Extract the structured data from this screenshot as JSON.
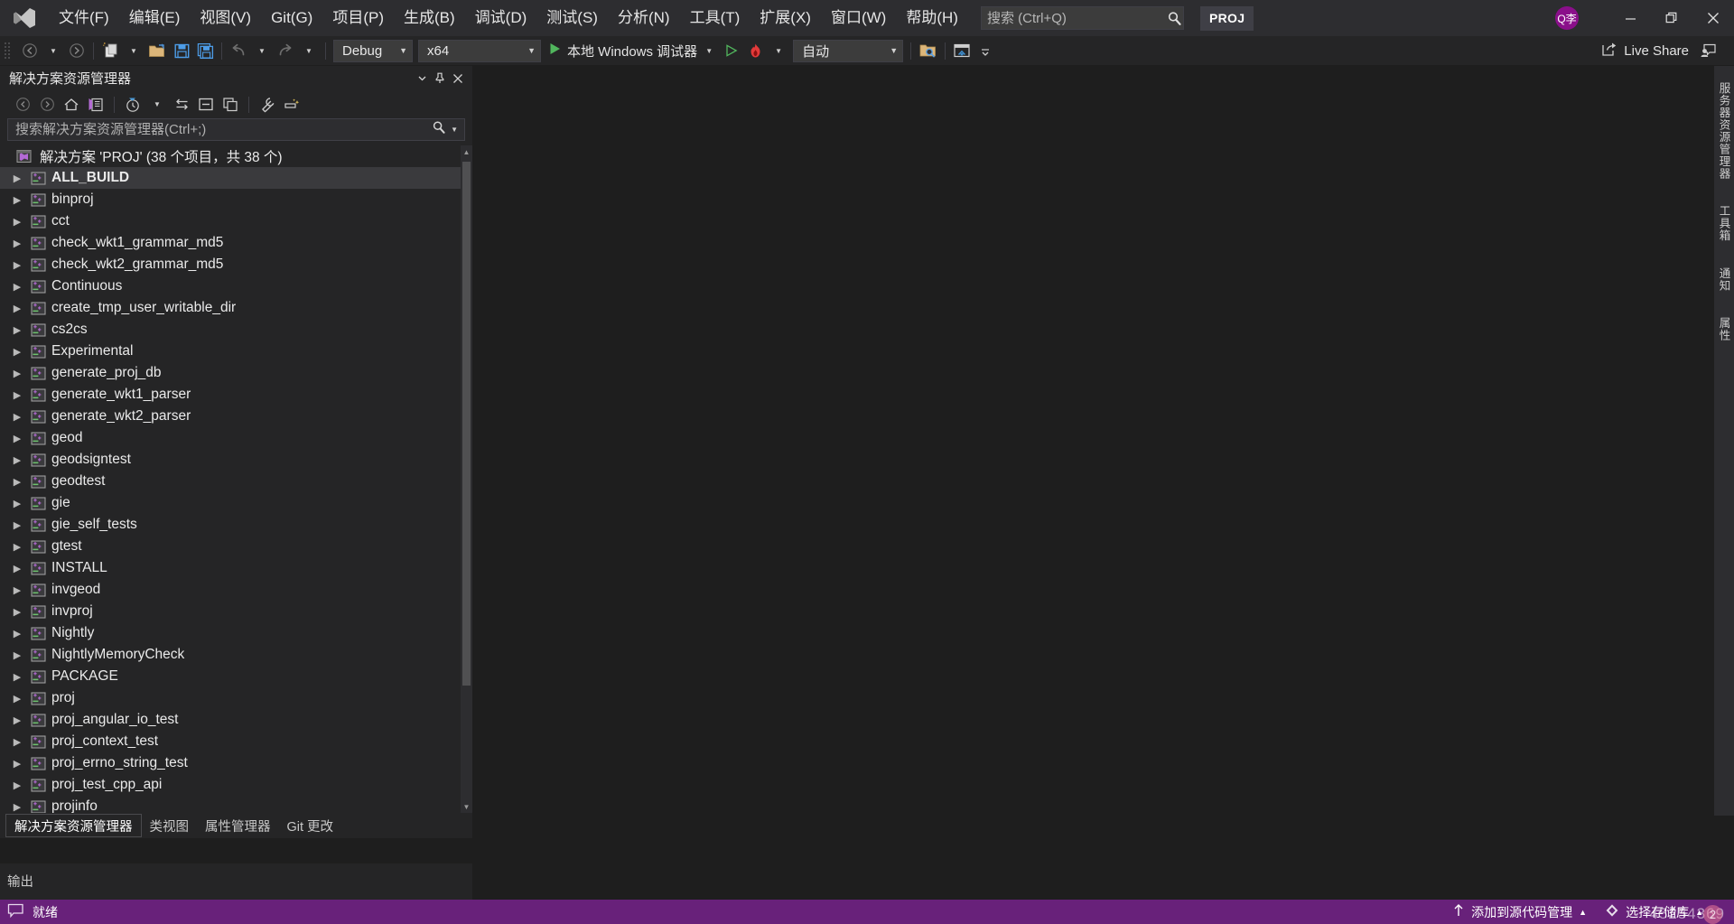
{
  "app": {
    "title_badge": "PROJ",
    "logo_icon": "visual-studio-logo-icon"
  },
  "menu": {
    "items": [
      {
        "label": "文件(F)",
        "name": "menu-file"
      },
      {
        "label": "编辑(E)",
        "name": "menu-edit"
      },
      {
        "label": "视图(V)",
        "name": "menu-view"
      },
      {
        "label": "Git(G)",
        "name": "menu-git"
      },
      {
        "label": "项目(P)",
        "name": "menu-project"
      },
      {
        "label": "生成(B)",
        "name": "menu-build"
      },
      {
        "label": "调试(D)",
        "name": "menu-debug"
      },
      {
        "label": "测试(S)",
        "name": "menu-test"
      },
      {
        "label": "分析(N)",
        "name": "menu-analyze"
      },
      {
        "label": "工具(T)",
        "name": "menu-tools"
      },
      {
        "label": "扩展(X)",
        "name": "menu-extensions"
      },
      {
        "label": "窗口(W)",
        "name": "menu-window"
      },
      {
        "label": "帮助(H)",
        "name": "menu-help"
      }
    ]
  },
  "search": {
    "placeholder": "搜索 (Ctrl+Q)",
    "value": "",
    "icon": "magnifier-icon"
  },
  "account": {
    "initials": "Q李",
    "color": "#8a0f8a"
  },
  "window_controls": {
    "minimize": "—",
    "restore": "restore-icon",
    "close": "✕"
  },
  "toolbar": {
    "back_icon": "arrow-back-icon",
    "forward_icon": "arrow-forward-icon",
    "new_item_icon": "new-project-icon",
    "open_icon": "open-folder-icon",
    "save_icon": "save-icon",
    "save_all_icon": "save-all-icon",
    "undo_icon": "undo-icon",
    "redo_icon": "redo-icon",
    "configuration": "Debug",
    "platform": "x64",
    "run_label": "本地 Windows 调试器",
    "run_icon": "play-icon",
    "start_no_debug_icon": "play-outline-icon",
    "hot_reload_icon": "hot-reload-flame-icon",
    "hot_reload_mode": "自动",
    "find_in_files_icon": "find-in-files-icon",
    "window_layout_icon": "window-layout-icon",
    "overflow_icon": "toolbar-overflow-icon",
    "live_share": "Live Share",
    "live_share_icon": "live-share-icon",
    "feedback_icon": "send-feedback-icon"
  },
  "solution_explorer": {
    "title": "解决方案资源管理器",
    "header_buttons": {
      "dropdown": "chevron-down-icon",
      "pin": "pin-icon",
      "close": "close-icon"
    },
    "toolbar_icons": [
      "nav-back-icon",
      "nav-forward-icon",
      "home-icon",
      "switch-views-icon",
      "pending-changes-filter-icon",
      "filter-dropdown-icon",
      "sync-with-active-document-icon",
      "collapse-all-icon",
      "show-all-files-icon",
      "properties-icon",
      "preview-selected-items-icon"
    ],
    "search_placeholder": "搜索解决方案资源管理器(Ctrl+;)",
    "search_value": "",
    "search_icon": "magnifier-icon",
    "root": {
      "label": "解决方案 'PROJ' (38 个项目，共 38 个)",
      "icon": "solution-icon"
    },
    "selected_item": "ALL_BUILD",
    "projects": [
      "ALL_BUILD",
      "binproj",
      "cct",
      "check_wkt1_grammar_md5",
      "check_wkt2_grammar_md5",
      "Continuous",
      "create_tmp_user_writable_dir",
      "cs2cs",
      "Experimental",
      "generate_proj_db",
      "generate_wkt1_parser",
      "generate_wkt2_parser",
      "geod",
      "geodsigntest",
      "geodtest",
      "gie",
      "gie_self_tests",
      "gtest",
      "INSTALL",
      "invgeod",
      "invproj",
      "Nightly",
      "NightlyMemoryCheck",
      "PACKAGE",
      "proj",
      "proj_angular_io_test",
      "proj_context_test",
      "proj_errno_string_test",
      "proj_test_cpp_api",
      "projinfo"
    ],
    "tabs": [
      {
        "label": "解决方案资源管理器",
        "active": true
      },
      {
        "label": "类视图",
        "active": false
      },
      {
        "label": "属性管理器",
        "active": false
      },
      {
        "label": "Git 更改",
        "active": false
      }
    ]
  },
  "output_panel": {
    "label": "输出"
  },
  "right_rail": {
    "tabs": [
      "服务器资源管理器",
      "工具箱",
      "通知",
      "属性"
    ]
  },
  "statusbar": {
    "ready_icon": "speech-bubble-icon",
    "ready": "就绪",
    "source_control_icon": "upload-arrow-icon",
    "source_control": "添加到源代码管理",
    "source_control_caret": "▲",
    "repo_icon": "repository-icon",
    "repo": "选择存储库",
    "repo_caret": "▲",
    "watermark_text": "45254369",
    "watermark_badge": "2",
    "accent": "#68217a"
  }
}
